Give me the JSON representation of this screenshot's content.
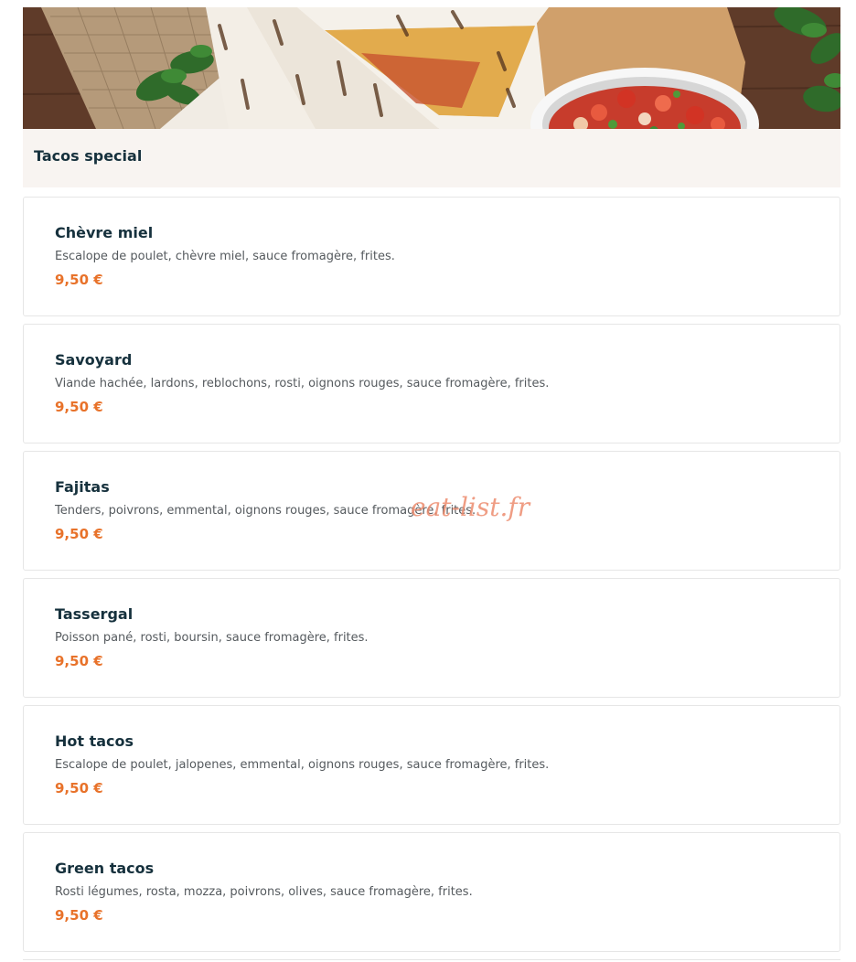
{
  "section": {
    "title": "Tacos special"
  },
  "items": [
    {
      "name": "Chèvre miel",
      "description": "Escalope de poulet, chèvre miel, sauce fromagère, frites.",
      "price": "9,50 €"
    },
    {
      "name": "Savoyard",
      "description": "Viande hachée, lardons, reblochons, rosti, oignons rouges, sauce fromagère, frites.",
      "price": "9,50 €"
    },
    {
      "name": "Fajitas",
      "description": "Tenders, poivrons, emmental, oignons rouges, sauce fromagère, frites.",
      "price": "9,50 €"
    },
    {
      "name": "Tassergal",
      "description": "Poisson pané, rosti, boursin, sauce fromagère, frites.",
      "price": "9,50 €"
    },
    {
      "name": "Hot tacos",
      "description": "Escalope de poulet, jalopenes, emmental, oignons rouges, sauce fromagère, frites.",
      "price": "9,50 €"
    },
    {
      "name": "Green tacos",
      "description": "Rosti légumes, rosta, mozza, poivrons, olives, sauce fromagère, frites.",
      "price": "9,50 €"
    }
  ],
  "watermark": "eat-list.fr",
  "colors": {
    "title": "#16313d",
    "description": "#555a5e",
    "price": "#e8722a",
    "header_bg": "#f8f4f1",
    "card_border": "#e6e6e6"
  }
}
